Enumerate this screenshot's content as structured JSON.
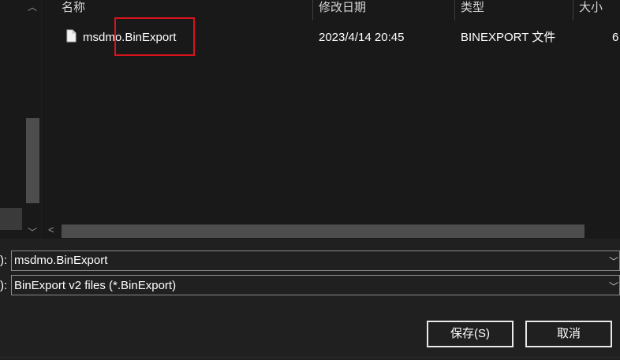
{
  "columns": {
    "name": "名称",
    "modified": "修改日期",
    "type": "类型",
    "size": "大小"
  },
  "file": {
    "name": "msdmo.BinExport",
    "modified": "2023/4/14 20:45",
    "type": "BINEXPORT 文件",
    "size_partial": "6"
  },
  "form": {
    "filename_label_tail": "):",
    "filename_value": "msdmo.BinExport",
    "filetype_label_tail": "):",
    "filetype_value": "BinExport v2 files (*.BinExport)"
  },
  "buttons": {
    "save": "保存(S)",
    "cancel": "取消"
  },
  "icons": {
    "file": "document-icon",
    "dropdown": "chevron-down-icon",
    "scroll_up": "chevron-up-icon",
    "scroll_down": "chevron-down-icon",
    "scroll_left": "chevron-left-icon"
  },
  "colors": {
    "highlight": "#d8131a",
    "background": "#202020",
    "pane": "#191919"
  }
}
